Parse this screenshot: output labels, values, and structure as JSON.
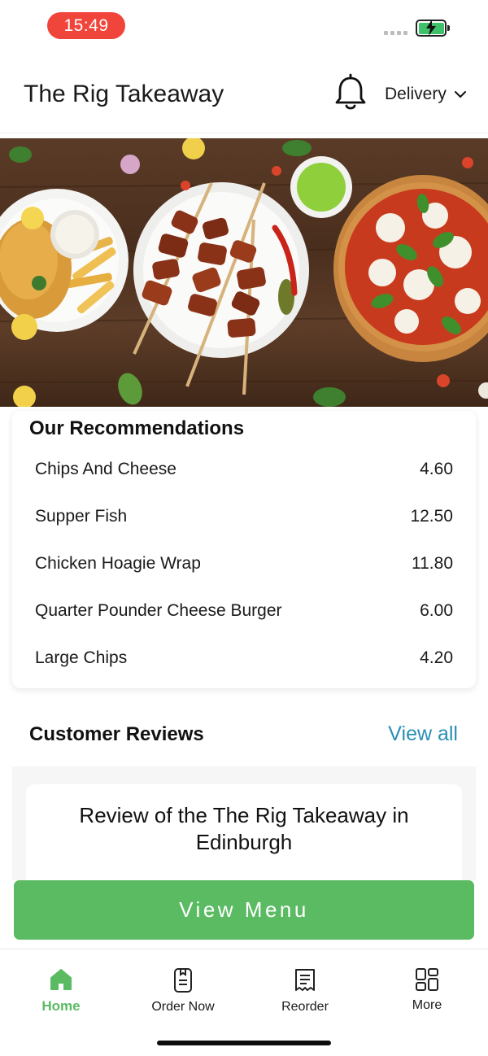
{
  "status_bar": {
    "time": "15:49",
    "battery_icon": "battery-charging-icon"
  },
  "header": {
    "title": "The Rig Takeaway",
    "notification_icon": "bell-icon",
    "mode_label": "Delivery"
  },
  "hero": {
    "image": "food-banner-fish-and-chips-kebab-skewers-pizza"
  },
  "recommendations": {
    "title": "Our Recommendations",
    "items": [
      {
        "name": "Chips And Cheese",
        "price": "4.60"
      },
      {
        "name": "Supper Fish",
        "price": "12.50"
      },
      {
        "name": "Chicken Hoagie Wrap",
        "price": "11.80"
      },
      {
        "name": "Quarter Pounder Cheese Burger",
        "price": "6.00"
      },
      {
        "name": "Large Chips",
        "price": "4.20"
      }
    ]
  },
  "reviews": {
    "title": "Customer Reviews",
    "view_all_label": "View all",
    "review_heading": "Review of the The Rig Takeaway in Edinburgh"
  },
  "cta": {
    "label": "View Menu"
  },
  "tab_bar": {
    "tabs": [
      {
        "label": "Home",
        "icon": "home-icon",
        "active": true
      },
      {
        "label": "Order Now",
        "icon": "order-icon",
        "active": false
      },
      {
        "label": "Reorder",
        "icon": "receipt-icon",
        "active": false
      },
      {
        "label": "More",
        "icon": "grid-icon",
        "active": false
      }
    ]
  },
  "colors": {
    "accent_green": "#5abb63",
    "link_blue": "#2a8fb4",
    "time_pill_red": "#f0453a"
  }
}
